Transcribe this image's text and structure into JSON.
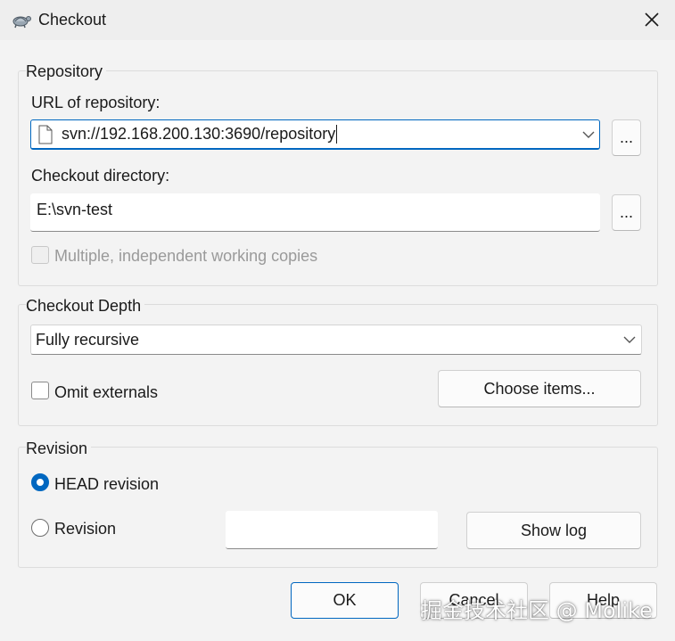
{
  "window": {
    "title": "Checkout",
    "app_icon": "tortoisesvn-icon",
    "close_icon": "close-icon"
  },
  "repository": {
    "legend": "Repository",
    "url_label": "URL of repository:",
    "url_value": "svn://192.168.200.130:3690/repository",
    "browse_label": "...",
    "dir_label": "Checkout directory:",
    "dir_value": "E:\\svn-test",
    "dir_browse_label": "...",
    "multiple_label": "Multiple, independent working copies"
  },
  "depth": {
    "legend": "Checkout Depth",
    "selected": "Fully recursive",
    "omit_label": "Omit externals",
    "choose_label": "Choose items..."
  },
  "revision": {
    "legend": "Revision",
    "head_label": "HEAD revision",
    "revision_label": "Revision",
    "revision_value": "",
    "show_log_label": "Show log"
  },
  "buttons": {
    "ok": "OK",
    "cancel": "Cancel",
    "help": "Help"
  },
  "watermark": "掘金技术社区 @ Molike",
  "colors": {
    "accent": "#0067c0",
    "background": "#f3f3f3"
  }
}
